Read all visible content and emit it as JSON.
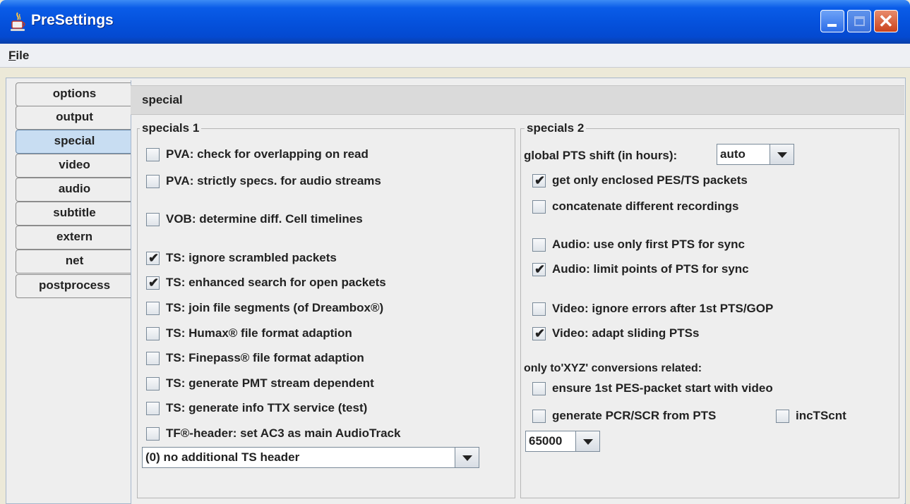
{
  "window": {
    "title": "PreSettings",
    "icon": "java-cup-icon"
  },
  "menu": {
    "file": "File",
    "file_mnemonic": "F",
    "file_rest": "ile"
  },
  "tabs": [
    {
      "label": "options",
      "selected": false
    },
    {
      "label": "output",
      "selected": false
    },
    {
      "label": "special",
      "selected": true
    },
    {
      "label": "video",
      "selected": false
    },
    {
      "label": "audio",
      "selected": false
    },
    {
      "label": "subtitle",
      "selected": false
    },
    {
      "label": "extern",
      "selected": false
    },
    {
      "label": "net",
      "selected": false
    },
    {
      "label": "postprocess",
      "selected": false
    }
  ],
  "panel": {
    "title": "special",
    "specials1": {
      "title": "specials 1",
      "items": [
        {
          "label": "PVA: check for overlapping on read",
          "checked": false
        },
        {
          "label": "PVA: strictly specs. for audio streams",
          "checked": false
        },
        {
          "label": "VOB: determine diff. Cell timelines",
          "checked": false
        },
        {
          "label": "TS: ignore scrambled packets",
          "checked": true
        },
        {
          "label": "TS: enhanced search for open packets",
          "checked": true
        },
        {
          "label": "TS: join file segments (of Dreambox®)",
          "checked": false
        },
        {
          "label": "TS: Humax® file format adaption",
          "checked": false
        },
        {
          "label": "TS: Finepass® file format adaption",
          "checked": false
        },
        {
          "label": "TS: generate PMT stream dependent",
          "checked": false
        },
        {
          "label": "TS: generate info TTX service (test)",
          "checked": false
        },
        {
          "label": "TF®-header: set AC3 as main AudioTrack",
          "checked": false
        }
      ],
      "header_select": "(0) no additional TS header"
    },
    "specials2": {
      "title": "specials 2",
      "pts_shift_label": "global PTS shift (in hours):",
      "pts_shift_value": "auto",
      "items": [
        {
          "label": "get only enclosed PES/TS packets",
          "checked": true
        },
        {
          "label": "concatenate different recordings",
          "checked": false
        },
        {
          "label": "Audio: use only first PTS for sync",
          "checked": false
        },
        {
          "label": "Audio: limit points of PTS for sync",
          "checked": true
        },
        {
          "label": "Video: ignore errors after 1st PTS/GOP",
          "checked": false
        },
        {
          "label": "Video: adapt sliding PTSs",
          "checked": true
        }
      ],
      "xyz_label": "only to'XYZ' conversions related:",
      "xyz_items": [
        {
          "label": "ensure 1st PES-packet start with video",
          "checked": false
        },
        {
          "label": "generate PCR/SCR from PTS",
          "checked": false
        },
        {
          "label": "incTScnt",
          "checked": false
        }
      ],
      "value_select": "65000"
    }
  },
  "colors": {
    "titlebar": "#0552dd",
    "selected_tab": "#c8ddf2",
    "close_button": "#c9431d"
  }
}
